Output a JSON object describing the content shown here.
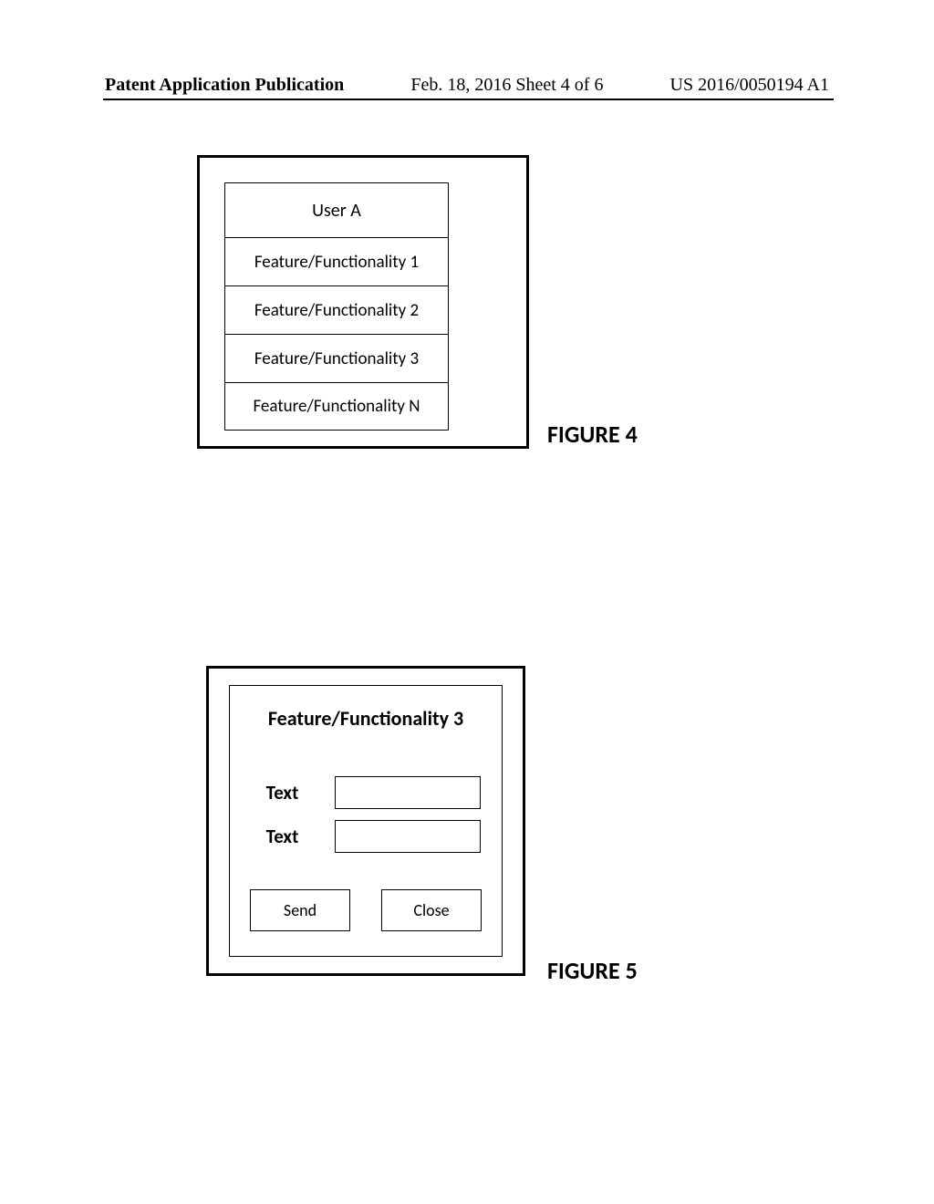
{
  "header": {
    "left": "Patent Application Publication",
    "center": "Feb. 18, 2016  Sheet 4 of 6",
    "right": "US 2016/0050194 A1"
  },
  "figure4": {
    "label": "FIGURE 4",
    "rows": [
      "User A",
      "Feature/Functionality 1",
      "Feature/Functionality 2",
      "Feature/Functionality 3",
      "Feature/Functionality N"
    ]
  },
  "figure5": {
    "label": "FIGURE 5",
    "title": "Feature/Functionality 3",
    "fields": [
      {
        "label": "Text"
      },
      {
        "label": "Text"
      }
    ],
    "buttons": {
      "send": "Send",
      "close": "Close"
    }
  }
}
